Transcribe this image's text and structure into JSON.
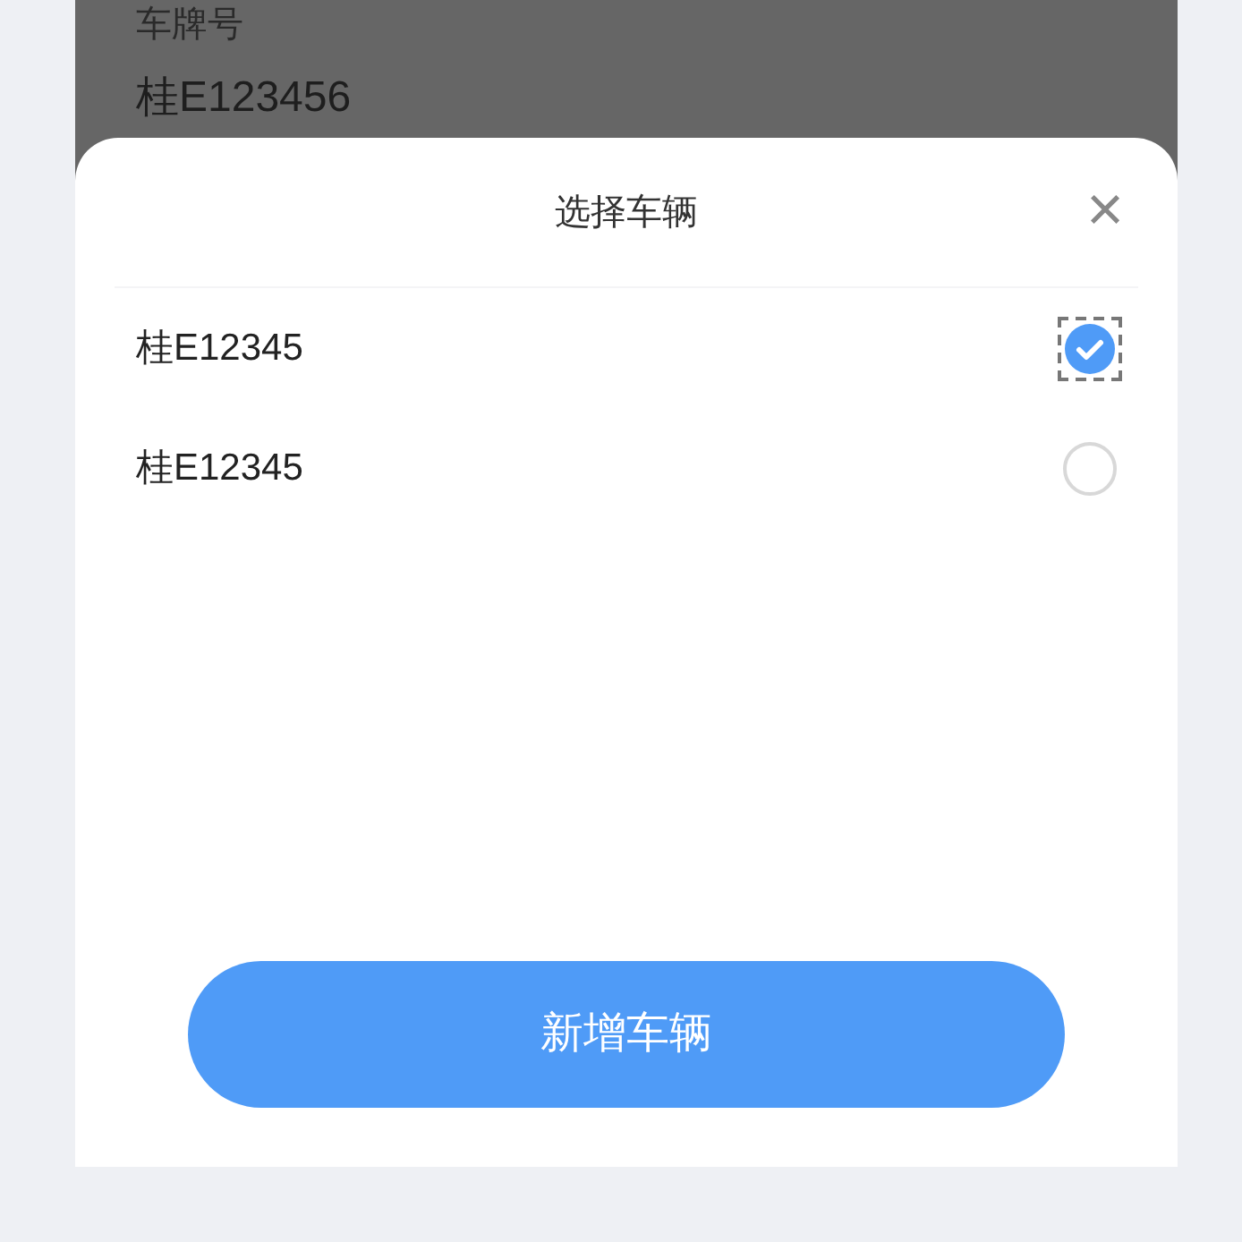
{
  "background_form": {
    "field_label": "车牌号",
    "field_value": "桂E123456"
  },
  "sheet": {
    "title": "选择车辆",
    "close": "×",
    "vehicles": [
      {
        "plate": "桂E12345",
        "selected": true
      },
      {
        "plate": "桂E12345",
        "selected": false
      }
    ],
    "add_button": "新增车辆"
  }
}
